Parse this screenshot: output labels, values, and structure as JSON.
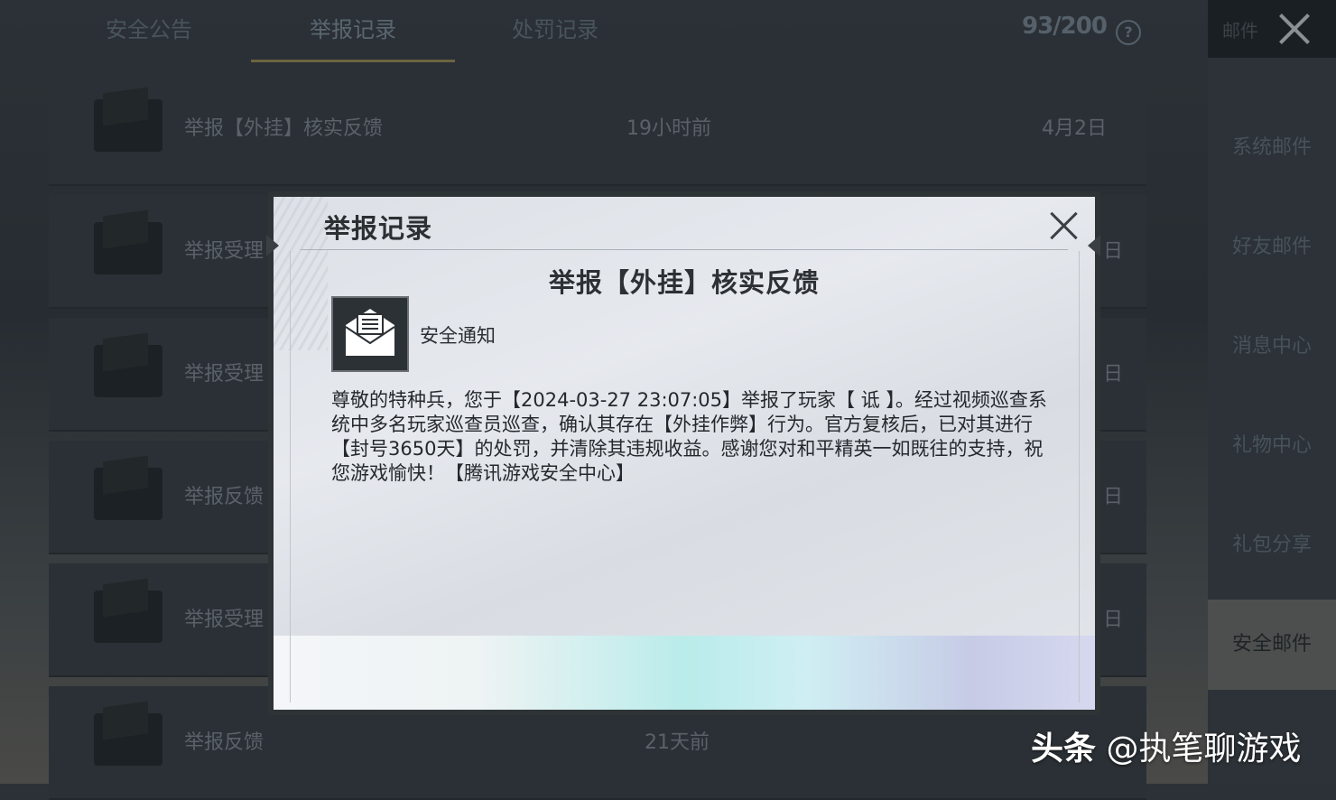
{
  "background": {
    "tabs": [
      "安全公告",
      "举报记录",
      "处罚记录"
    ],
    "active_tab_index": 1,
    "counter": "93/200",
    "mail_header_label": "邮件",
    "side_nav": [
      "系统邮件",
      "好友邮件",
      "消息中心",
      "礼物中心",
      "礼包分享",
      "安全邮件"
    ],
    "active_side_index": 5,
    "rows": [
      {
        "title": "举报【外挂】核实反馈",
        "time": "19小时前",
        "date": "4月2日"
      },
      {
        "title": "举报受理",
        "time": "",
        "date": "日"
      },
      {
        "title": "举报受理",
        "time": "",
        "date": "日"
      },
      {
        "title": "举报反馈",
        "time": "",
        "date": "日"
      },
      {
        "title": "举报受理",
        "time": "",
        "date": "日"
      },
      {
        "title": "举报反馈",
        "time": "21天前",
        "date": ""
      }
    ]
  },
  "modal": {
    "title": "举报记录",
    "subject": "举报【外挂】核实反馈",
    "sender_icon": "envelope-icon",
    "sender": "安全通知",
    "body": "尊敬的特种兵，您于【2024-03-27 23:07:05】举报了玩家【 诋 】。经过视频巡查系统中多名玩家巡查员巡查，确认其存在【外挂作弊】行为。官方复核后，已对其进行【封号3650天】的处罚，并清除其违规收益。感谢您对和平精英一如既往的支持，祝您游戏愉快！【腾讯游戏安全中心】"
  },
  "watermark": {
    "brand": "头条",
    "handle": "@执笔聊游戏"
  }
}
